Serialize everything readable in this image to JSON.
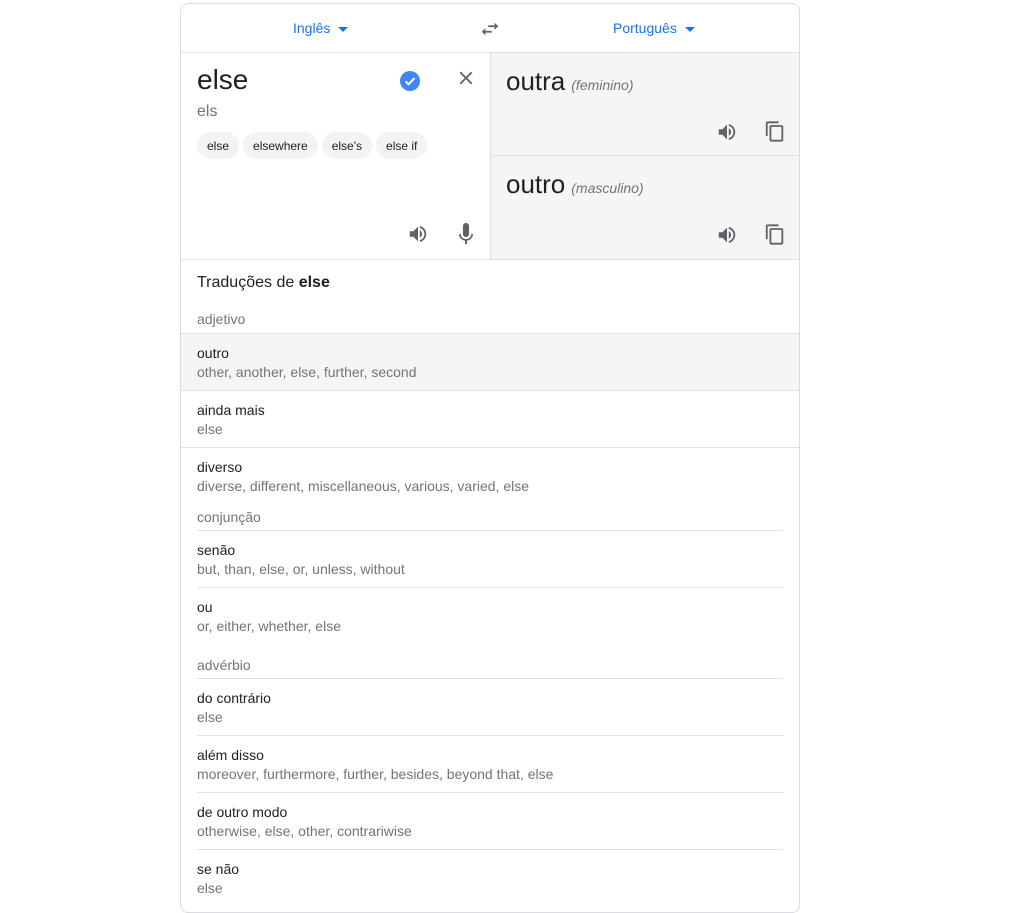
{
  "languages": {
    "source": "Inglês",
    "target": "Português"
  },
  "source": {
    "text": "else",
    "phonetic": "els",
    "suggestions": [
      "else",
      "elsewhere",
      "else's",
      "else if"
    ]
  },
  "translations": [
    {
      "word": "outra",
      "gender": "(feminino)"
    },
    {
      "word": "outro",
      "gender": "(masculino)"
    }
  ],
  "dictionary": {
    "title_prefix": "Traduções de",
    "title_word": "else",
    "groups": [
      {
        "pos": "adjetivo",
        "entries": [
          {
            "word": "outro",
            "synonyms": "other, another, else, further, second"
          },
          {
            "word": "ainda mais",
            "synonyms": "else"
          },
          {
            "word": "diverso",
            "synonyms": "diverse, different, miscellaneous, various, varied, else"
          }
        ]
      },
      {
        "pos": "conjunção",
        "entries": [
          {
            "word": "senão",
            "synonyms": "but, than, else, or, unless, without"
          },
          {
            "word": "ou",
            "synonyms": "or, either, whether, else"
          }
        ]
      },
      {
        "pos": "advérbio",
        "entries": [
          {
            "word": "do contrário",
            "synonyms": "else"
          },
          {
            "word": "além disso",
            "synonyms": "moreover, furthermore, further, besides, beyond that, else"
          },
          {
            "word": "de outro modo",
            "synonyms": "otherwise, else, other, contrariwise"
          },
          {
            "word": "se não",
            "synonyms": "else"
          }
        ]
      }
    ]
  },
  "icons": {
    "swap": "swap-icon",
    "verified": "check-circle-icon",
    "clear": "close-icon",
    "speaker": "volume-icon",
    "mic": "mic-icon",
    "copy": "copy-icon"
  },
  "colors": {
    "accent": "#1a73e8",
    "verified": "#4285f4",
    "icon": "#5f6368"
  }
}
